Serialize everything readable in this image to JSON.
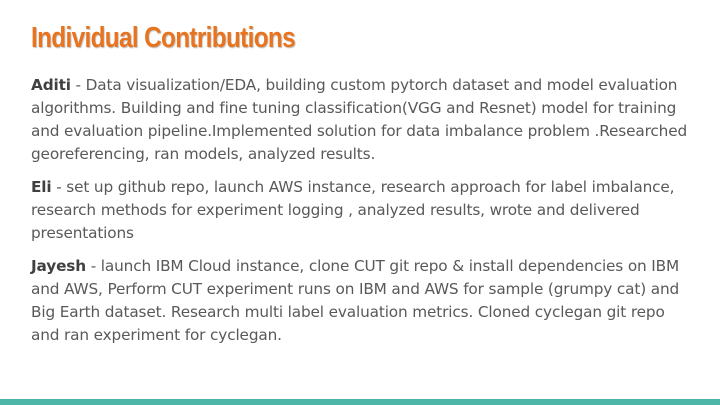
{
  "slide": {
    "title": "Individual Contributions",
    "contributions": [
      {
        "name": "Aditi",
        "text": " - Data visualization/EDA, building custom pytorch dataset and model evaluation algorithms. Building and fine tuning classification(VGG and Resnet) model for training and evaluation pipeline.Implemented solution for data imbalance problem .Researched georeferencing, ran models, analyzed results."
      },
      {
        "name": "Eli",
        "text": " - set up github repo, launch AWS instance, research approach for label imbalance, research methods for experiment logging , analyzed results, wrote and delivered presentations"
      },
      {
        "name": "Jayesh",
        "text": " - launch IBM Cloud instance, clone CUT git repo & install dependencies on IBM and AWS, Perform CUT experiment runs on IBM and AWS for sample (grumpy cat) and Big Earth dataset. Research multi label evaluation metrics. Cloned cyclegan git repo and ran experiment for cyclegan."
      }
    ]
  },
  "colors": {
    "title": "#e8741f",
    "body_text": "#595959",
    "name_text": "#404040",
    "accent_bar": "#4db6a9",
    "background": "#ffffff"
  }
}
